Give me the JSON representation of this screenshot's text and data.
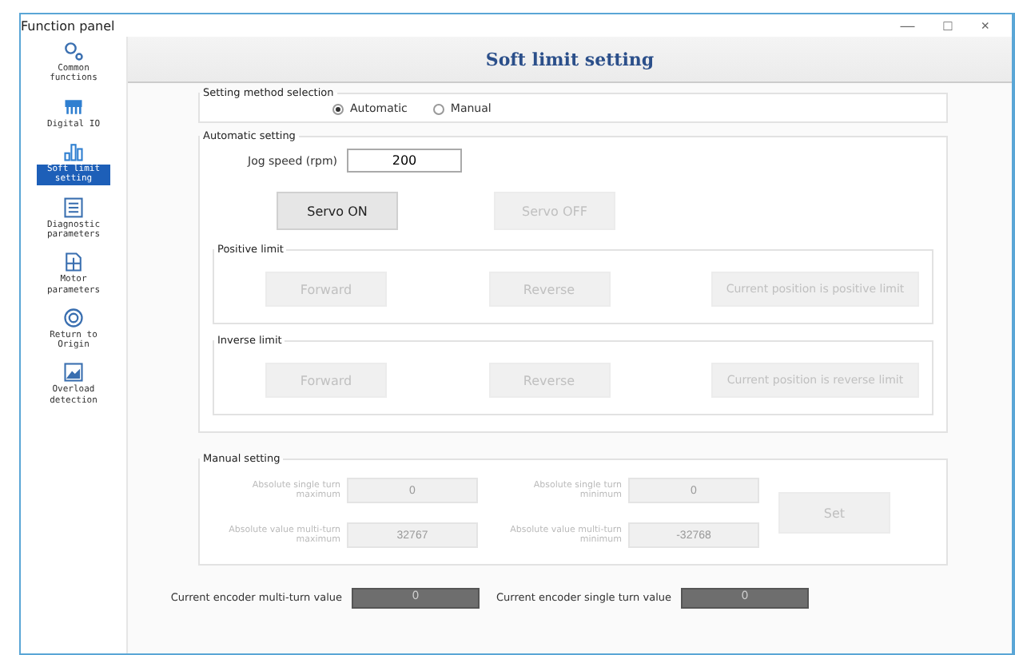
{
  "window": {
    "title": "Function panel",
    "controls": [
      "—",
      "□",
      "×"
    ]
  },
  "sidebar": {
    "items": [
      {
        "label": "Common functions",
        "selected": false
      },
      {
        "label": "Digital IO",
        "selected": false
      },
      {
        "label": "Soft limit setting",
        "selected": true
      },
      {
        "label": "Diagnostic parameters",
        "selected": false
      },
      {
        "label": "Motor parameters",
        "selected": false
      },
      {
        "label": "Return to Origin",
        "selected": false
      },
      {
        "label": "Overload detection",
        "selected": false
      }
    ]
  },
  "header": {
    "title": "Soft limit setting"
  },
  "method": {
    "title": "Setting method selection",
    "options": [
      {
        "label": "Automatic",
        "selected": true
      },
      {
        "label": "Manual",
        "selected": false
      }
    ]
  },
  "automatic": {
    "title": "Automatic setting",
    "jog_label": "Jog speed (rpm)",
    "jog_value": "200",
    "servo_buttons": [
      {
        "label": "Servo ON",
        "disabled": false
      },
      {
        "label": "Servo OFF",
        "disabled": true
      }
    ],
    "groups": [
      {
        "title": "Positive limit",
        "buttons": [
          {
            "label": "Forward",
            "disabled": true
          },
          {
            "label": "Reverse",
            "disabled": true
          },
          {
            "label": "Current position is positive limit",
            "disabled": true
          }
        ]
      },
      {
        "title": "Inverse limit",
        "buttons": [
          {
            "label": "Forward",
            "disabled": true
          },
          {
            "label": "Reverse",
            "disabled": true
          },
          {
            "label": "Current position is reverse limit",
            "disabled": true
          }
        ]
      }
    ]
  },
  "manual": {
    "title": "Manual setting",
    "disabled": true,
    "fields": [
      {
        "label": "Absolute single turn maximum",
        "value": "0"
      },
      {
        "label": "Absolute single turn minimum",
        "value": "0"
      },
      {
        "label": "Absolute value multi-turn maximum",
        "value": "32767"
      },
      {
        "label": "Absolute value multi-turn minimum",
        "value": "-32768"
      }
    ],
    "set_button": "Set"
  },
  "encoder": [
    {
      "label": "Current encoder multi-turn value",
      "value": "0"
    },
    {
      "label": "Current encoder single turn value",
      "value": "0"
    }
  ]
}
